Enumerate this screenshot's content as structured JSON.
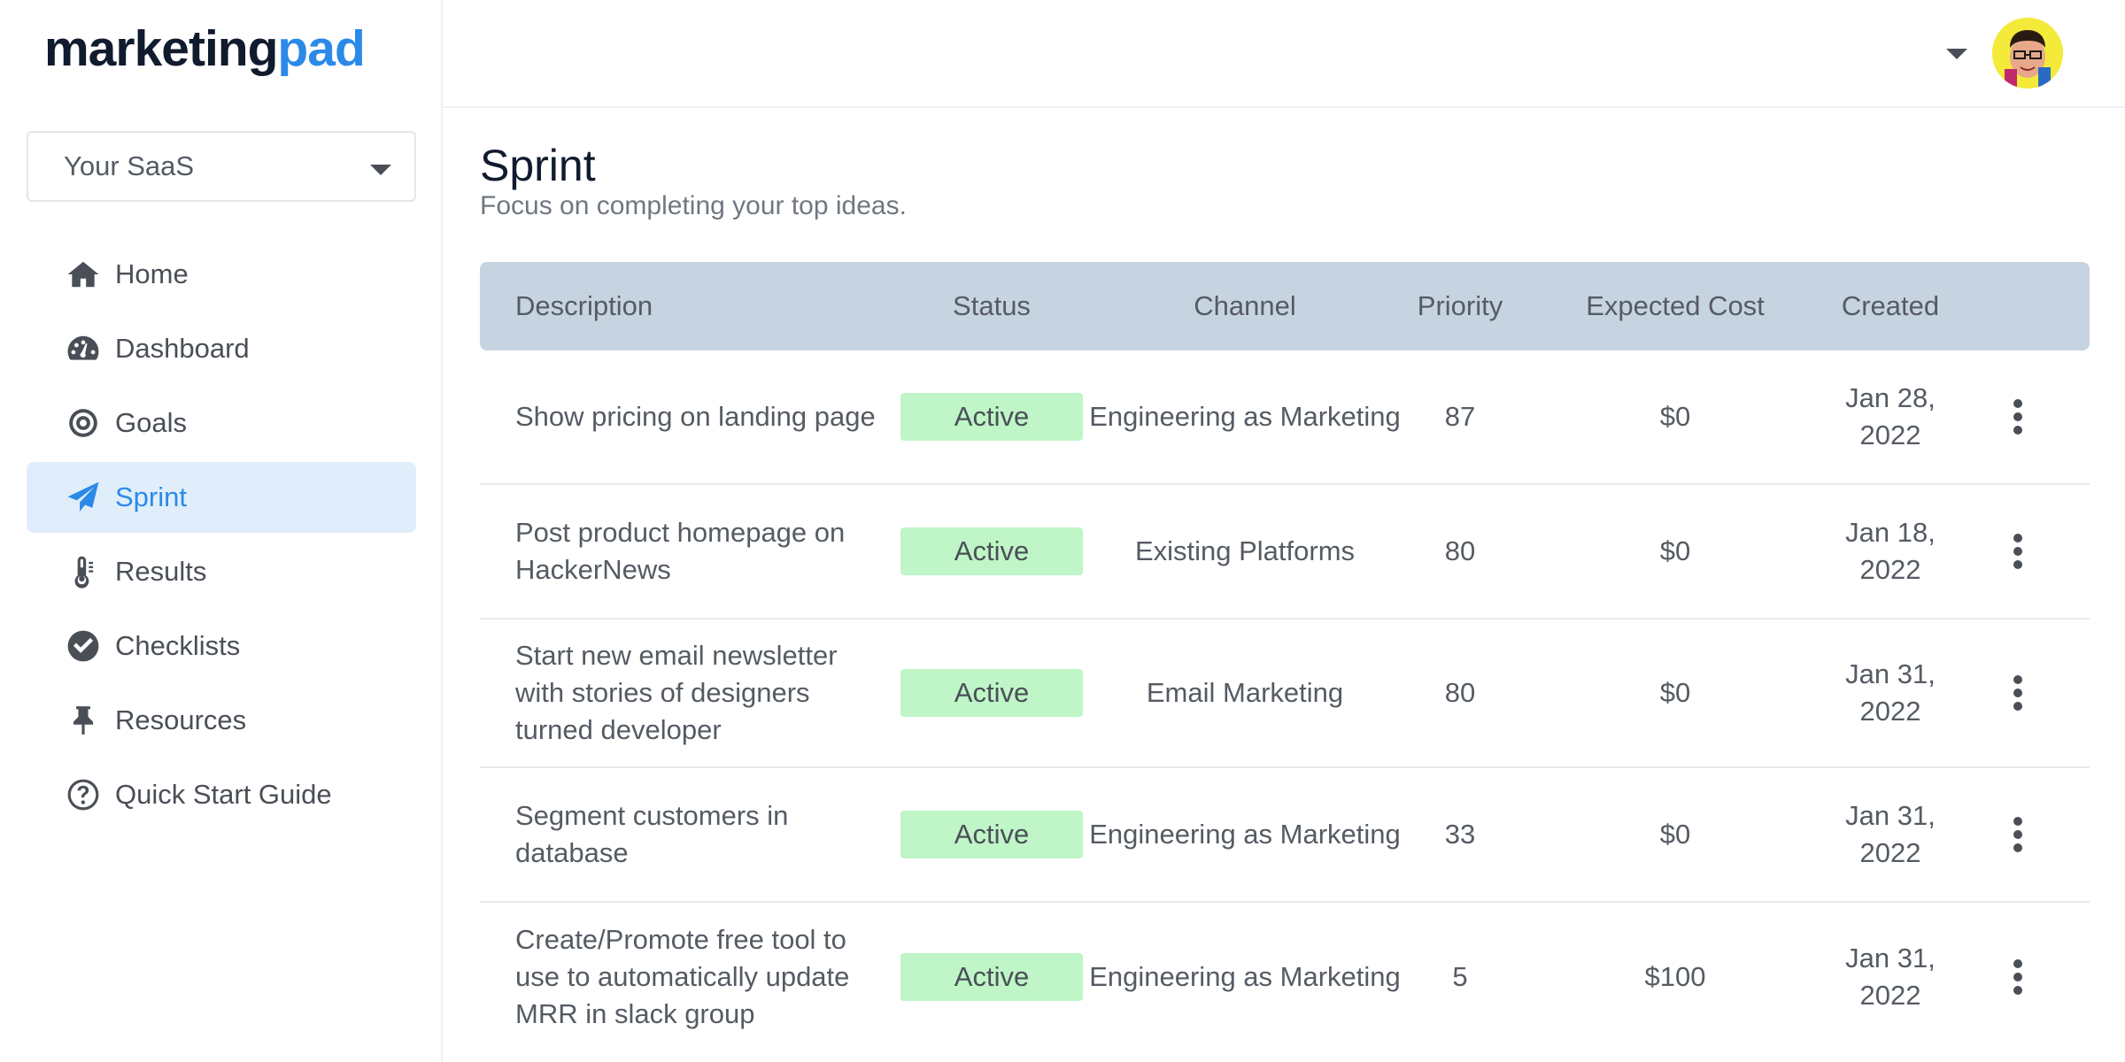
{
  "brand": {
    "part1": "marketing",
    "part2": "pad"
  },
  "workspace": {
    "selected": "Your SaaS"
  },
  "nav": [
    {
      "label": "Home",
      "icon": "home-icon",
      "active": false
    },
    {
      "label": "Dashboard",
      "icon": "dashboard-icon",
      "active": false
    },
    {
      "label": "Goals",
      "icon": "target-icon",
      "active": false
    },
    {
      "label": "Sprint",
      "icon": "paper-plane-icon",
      "active": true
    },
    {
      "label": "Results",
      "icon": "thermometer-icon",
      "active": false
    },
    {
      "label": "Checklists",
      "icon": "check-circle-icon",
      "active": false
    },
    {
      "label": "Resources",
      "icon": "pin-icon",
      "active": false
    },
    {
      "label": "Quick Start Guide",
      "icon": "question-circle-icon",
      "active": false
    }
  ],
  "page": {
    "title": "Sprint",
    "subtitle": "Focus on completing your top ideas."
  },
  "table": {
    "headers": {
      "description": "Description",
      "status": "Status",
      "channel": "Channel",
      "priority": "Priority",
      "cost": "Expected Cost",
      "created": "Created"
    },
    "rows": [
      {
        "description": "Show pricing on landing page",
        "status": "Active",
        "channel": "Engineering as Marketing",
        "priority": "87",
        "cost": "$0",
        "created": "Jan 28, 2022"
      },
      {
        "description": "Post product homepage on HackerNews",
        "status": "Active",
        "channel": "Existing Platforms",
        "priority": "80",
        "cost": "$0",
        "created": "Jan 18, 2022"
      },
      {
        "description": "Start new email newsletter with stories of designers turned developer",
        "status": "Active",
        "channel": "Email Marketing",
        "priority": "80",
        "cost": "$0",
        "created": "Jan 31, 2022"
      },
      {
        "description": "Segment customers in database",
        "status": "Active",
        "channel": "Engineering as Marketing",
        "priority": "33",
        "cost": "$0",
        "created": "Jan 31, 2022"
      },
      {
        "description": "Create/Promote free tool to use to automatically update MRR in slack group",
        "status": "Active",
        "channel": "Engineering as Marketing",
        "priority": "5",
        "cost": "$100",
        "created": "Jan 31, 2022"
      }
    ]
  },
  "colors": {
    "brand_blue": "#2b8ae8",
    "brand_dark": "#111b2e",
    "active_nav_bg": "#e0eefb",
    "table_header_bg": "#c6d3e0",
    "status_active_bg": "#bff5c7"
  }
}
